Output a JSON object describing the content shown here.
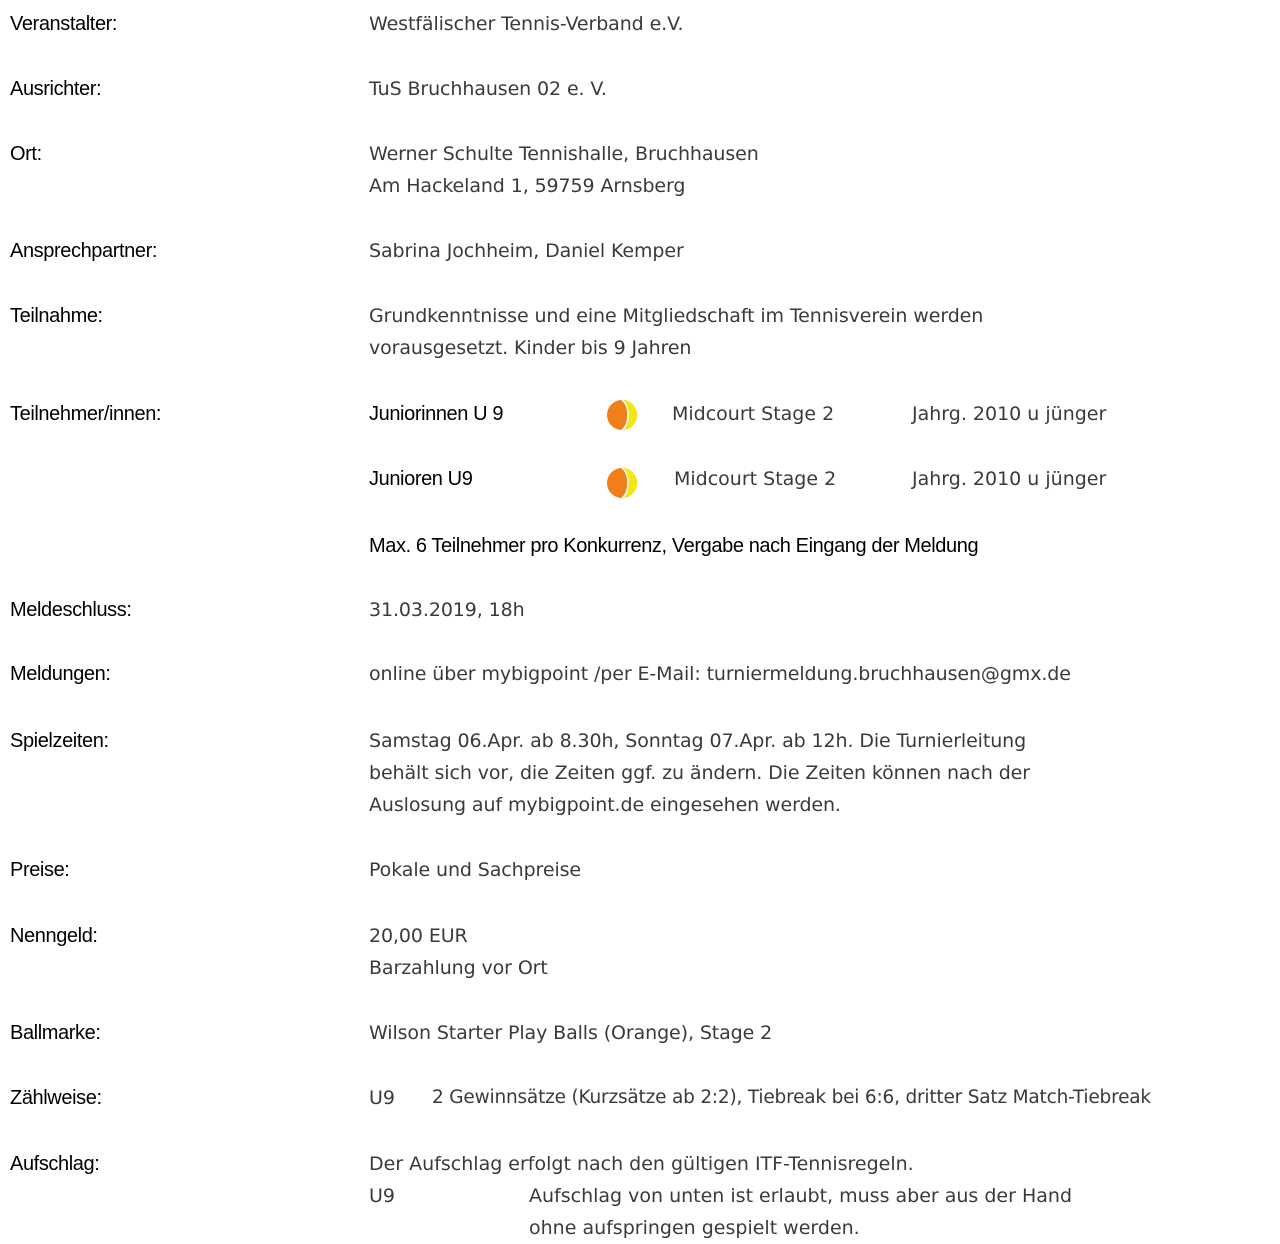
{
  "rows": {
    "veranstalter": {
      "label": "Veranstalter:",
      "value": "Westfälischer Tennis-Verband e.V."
    },
    "ausrichter": {
      "label": "Ausrichter:",
      "value": "TuS Bruchhausen 02 e. V."
    },
    "ort": {
      "label": "Ort:",
      "line1": "Werner Schulte Tennishalle, Bruchhausen",
      "line2": "Am Hackeland 1, 59759 Arnsberg"
    },
    "ansprechpartner": {
      "label": "Ansprechpartner:",
      "value": "Sabrina Jochheim, Daniel Kemper"
    },
    "teilnahme": {
      "label": "Teilnahme:",
      "line1": "Grundkenntnisse und eine Mitgliedschaft im Tennisverein werden",
      "line2": "vorausgesetzt. Kinder bis 9 Jahren"
    },
    "teilnehmer": {
      "label": "Teilnehmer/innen:",
      "groups": [
        {
          "name": "Juniorinnen U 9",
          "ball_icon": "orange-tennis-ball-icon",
          "stage": "Midcourt Stage 2",
          "jahrgang": "Jahrg. 2010 u jünger"
        },
        {
          "name": "Junioren U9",
          "ball_icon": "orange-tennis-ball-icon",
          "stage": "Midcourt Stage 2",
          "jahrgang": "Jahrg. 2010 u jünger"
        }
      ],
      "note": "Max. 6 Teilnehmer pro Konkurrenz, Vergabe nach Eingang der Meldung"
    },
    "meldeschluss": {
      "label": "Meldeschluss:",
      "value": "31.03.2019, 18h"
    },
    "meldungen": {
      "label": "Meldungen:",
      "value": "online über mybigpoint /per E-Mail: turniermeldung.bruchhausen@gmx.de"
    },
    "spielzeiten": {
      "label": "Spielzeiten:",
      "line1": "Samstag 06.Apr. ab 8.30h, Sonntag 07.Apr. ab 12h. Die Turnierleitung",
      "line2": "behält sich vor, die Zeiten ggf. zu ändern. Die Zeiten können nach der",
      "line3": "Auslosung auf mybigpoint.de eingesehen werden."
    },
    "preise": {
      "label": "Preise:",
      "value": "Pokale und Sachpreise"
    },
    "nenngeld": {
      "label": "Nenngeld:",
      "line1": "20,00 EUR",
      "line2": "Barzahlung vor Ort"
    },
    "ballmarke": {
      "label": "Ballmarke:",
      "value": "Wilson Starter Play Balls (Orange), Stage 2"
    },
    "zaehlweise": {
      "label": "Zählweise:",
      "category": "U9",
      "value": "2 Gewinnsätze (Kurzsätze ab 2:2), Tiebreak bei 6:6, dritter Satz Match-Tiebreak"
    },
    "aufschlag": {
      "label": "Aufschlag:",
      "line1": "Der Aufschlag erfolgt nach den gültigen ITF-Tennisregeln.",
      "category": "U9",
      "line2": "Aufschlag von unten ist erlaubt, muss aber aus der Hand",
      "line3": "ohne aufspringen gespielt werden."
    }
  },
  "colors": {
    "ball_orange": "#f07e1a",
    "ball_yellow": "#f5e60f"
  }
}
